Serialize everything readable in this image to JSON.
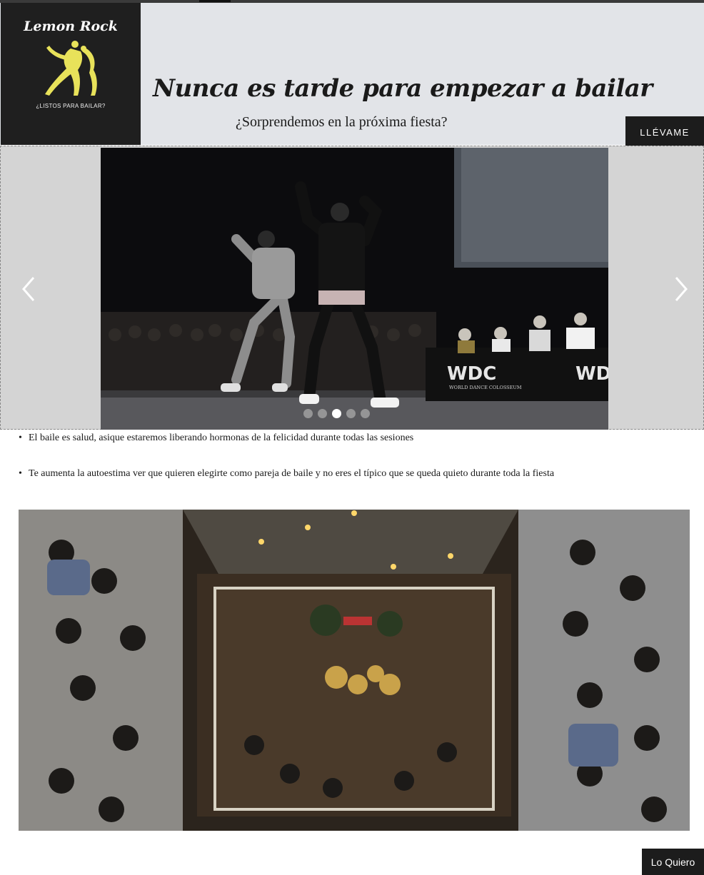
{
  "header": {
    "logo_title": "Lemon Rock",
    "logo_subtitle": "¿LISTOS PARA BAILAR?",
    "slogan": "Nunca es tarde para empezar a bailar",
    "subtitle": "¿Sorprendemos en la próxima fiesta?",
    "cta_label": "LLÉVAME"
  },
  "slider": {
    "banner_letters": "WDC",
    "banner_text": "WORLD DANCE COLOSSEUM",
    "dots_count": 5,
    "active_dot": 3
  },
  "bullets": [
    "El baile es salud, asique estaremos liberando hormonas de la felicidad durante todas las sesiones",
    "Te aumenta la autoestima ver que quieren elegirte como pareja de baile y no eres el típico que se queda quieto durante toda la fiesta"
  ],
  "footer": {
    "cta_label": "Lo Quiero"
  },
  "colors": {
    "header_bg": "#e2e4e8",
    "logo_bg": "#1f1f1f",
    "logo_accent": "#e8e25a",
    "button_bg": "#1c1c1c"
  },
  "icons": [
    "chevron-left-icon",
    "chevron-right-icon",
    "dancers-logo-icon"
  ]
}
